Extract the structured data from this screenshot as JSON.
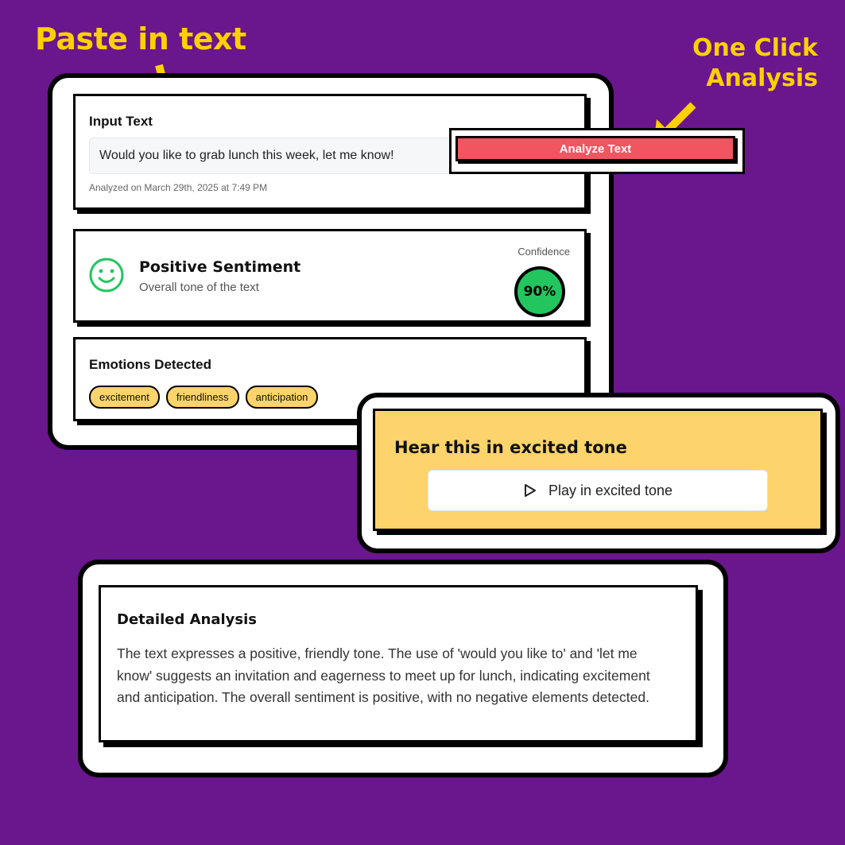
{
  "callouts": {
    "paste": "Paste in text",
    "one_click_line1": "One Click",
    "one_click_line2": "Analysis"
  },
  "colors": {
    "background": "#6a168c",
    "callout": "#ffd000",
    "analyze_button": "#f25560",
    "confidence": "#22c55e",
    "tag": "#fdd36b",
    "hear_card": "#fdd36b"
  },
  "input": {
    "heading": "Input Text",
    "value": "Would you like to grab lunch this week, let me know!",
    "analyzed_on": "Analyzed on March 29th, 2025 at 7:49 PM"
  },
  "analyze": {
    "label": "Analyze Text"
  },
  "sentiment": {
    "icon": "smile-icon",
    "title": "Positive Sentiment",
    "subtitle": "Overall tone of the text",
    "confidence_label": "Confidence",
    "confidence_value": "90%"
  },
  "emotions": {
    "heading": "Emotions Detected",
    "tags": [
      "excitement",
      "friendliness",
      "anticipation"
    ]
  },
  "hear": {
    "title": "Hear this in excited tone",
    "play_icon": "play-icon",
    "play_label": "Play in excited tone"
  },
  "detail": {
    "heading": "Detailed Analysis",
    "body": "The text expresses a positive, friendly tone. The use of 'would you like to' and 'let me know' suggests an invitation and eagerness to meet up for lunch, indicating excitement and anticipation. The overall sentiment is positive, with no negative elements detected."
  }
}
